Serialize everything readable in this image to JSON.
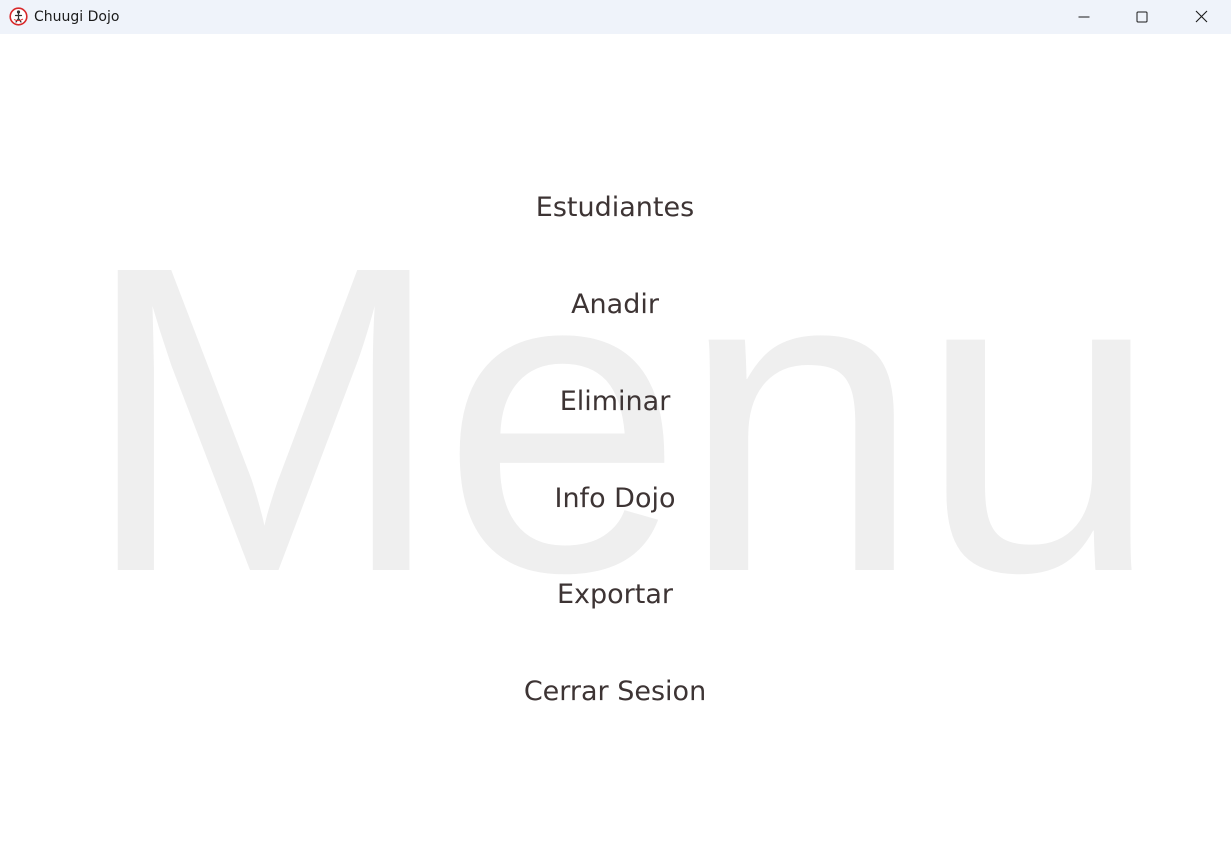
{
  "window": {
    "title": "Chuugi Dojo",
    "icon": "dojo-logo-icon",
    "controls": {
      "minimize_icon": "minimize-icon",
      "maximize_icon": "maximize-icon",
      "close_icon": "close-icon"
    }
  },
  "background_text": "Menu",
  "menu": {
    "items": [
      {
        "label": "Estudiantes"
      },
      {
        "label": "Anadir"
      },
      {
        "label": "Eliminar"
      },
      {
        "label": "Info Dojo"
      },
      {
        "label": "Exportar"
      },
      {
        "label": "Cerrar Sesion"
      }
    ]
  },
  "colors": {
    "titlebar_bg": "#eff3fa",
    "menu_text": "#3d3434",
    "watermark": "#efefef",
    "logo_red": "#d8282a"
  }
}
